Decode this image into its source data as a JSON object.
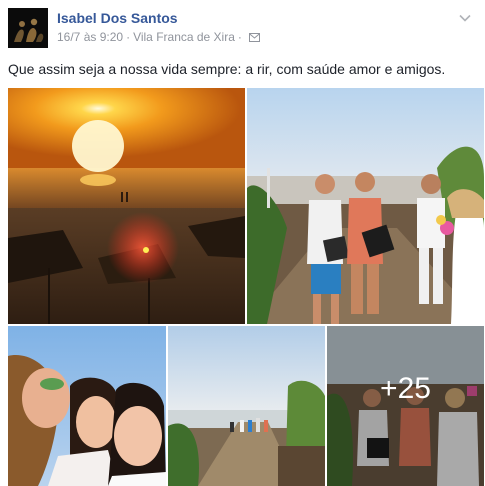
{
  "post": {
    "author": "Isabel Dos Santos",
    "date": "16/7 às 9:20",
    "separator": "·",
    "location": "Vila Franca de Xira",
    "privacy_icon": "envelope-icon",
    "menu_icon": "chevron-down-icon",
    "text": "Que assim seja a nossa vida sempre: a rir, com saúde amor e amigos."
  },
  "photos": {
    "items": [
      {
        "name": "photo-sunset-beach"
      },
      {
        "name": "photo-women-boardwalk"
      },
      {
        "name": "photo-selfie-three-women"
      },
      {
        "name": "photo-boardwalk-people"
      },
      {
        "name": "photo-group-more"
      }
    ],
    "more_label": "+25"
  },
  "colors": {
    "author_link": "#365899",
    "meta_text": "#90949c",
    "body_text": "#1d2129"
  }
}
